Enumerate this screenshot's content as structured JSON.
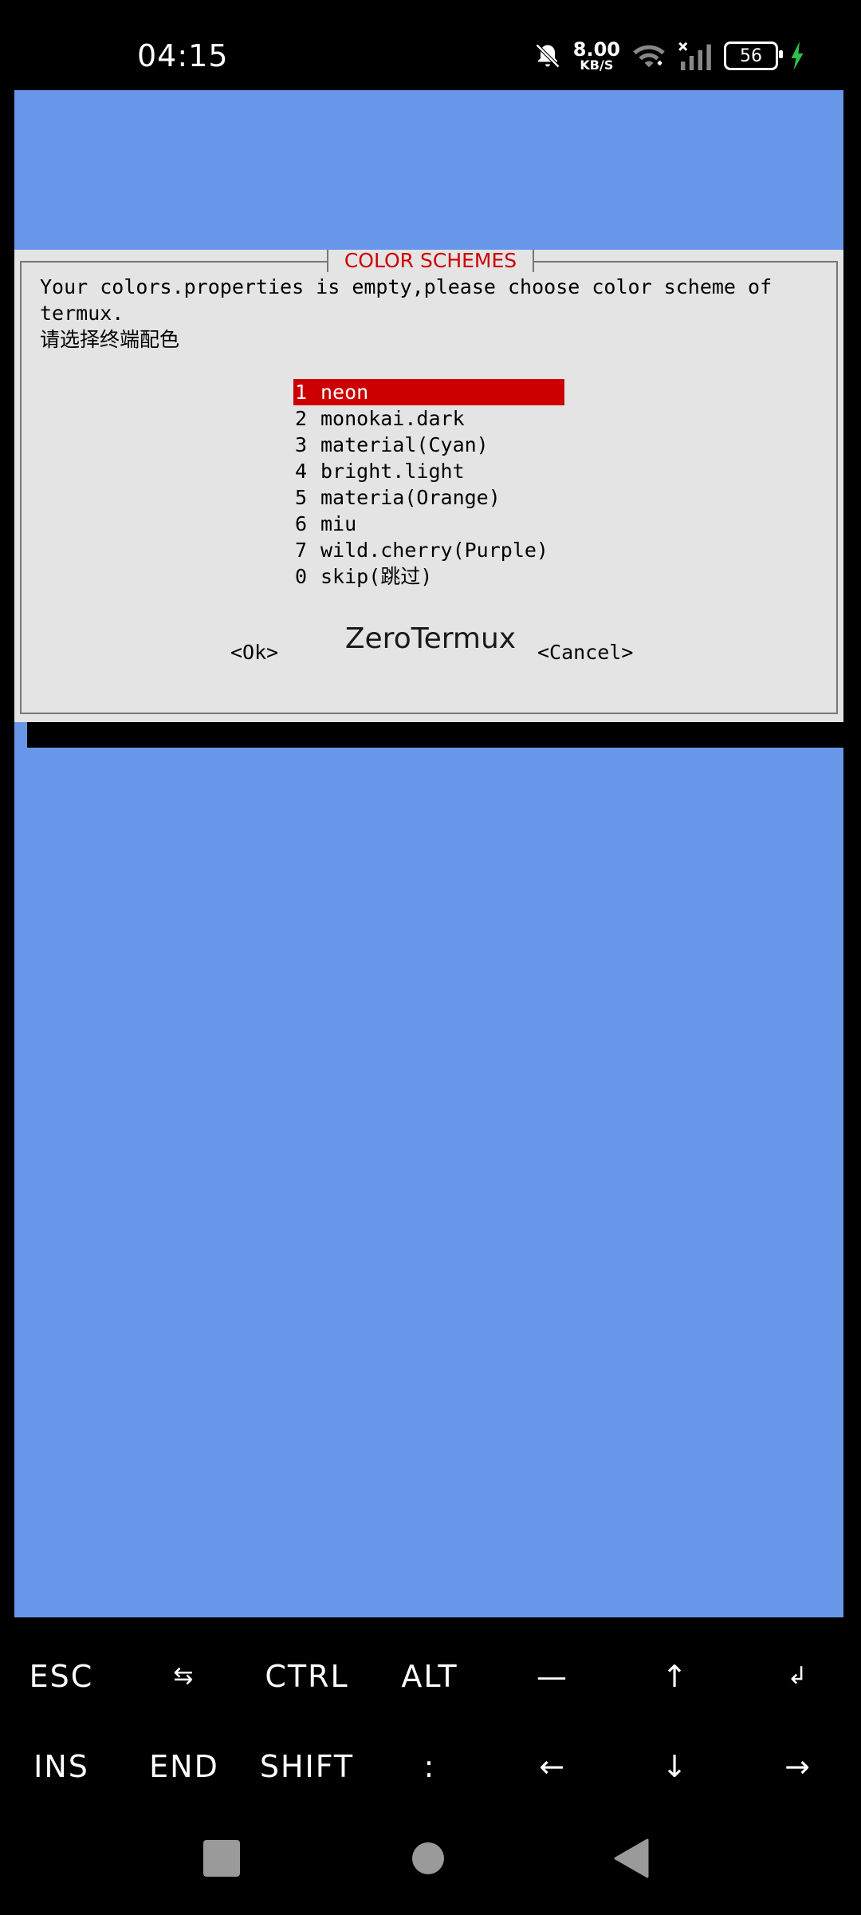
{
  "status_bar": {
    "time": "04:15",
    "net_speed_value": "8.00",
    "net_speed_unit": "KB/S",
    "battery": "56",
    "icons": [
      "bell-mute-icon",
      "wifi-icon",
      "signal-icon",
      "battery-icon",
      "charging-icon"
    ]
  },
  "dialog": {
    "title": "COLOR SCHEMES",
    "message_line1": "Your colors.properties is empty,please choose color scheme of",
    "message_line2": "termux.",
    "message_line3": "请选择终端配色",
    "options": [
      {
        "num": "1",
        "label": "neon",
        "selected": true
      },
      {
        "num": "2",
        "label": "monokai.dark"
      },
      {
        "num": "3",
        "label": "material(Cyan)"
      },
      {
        "num": "4",
        "label": "bright.light"
      },
      {
        "num": "5",
        "label": "materia(Orange)"
      },
      {
        "num": "6",
        "label": "miu"
      },
      {
        "num": "7",
        "label": "wild.cherry(Purple)"
      },
      {
        "num": "0",
        "label": "skip(跳过)"
      }
    ],
    "ok_label": "<Ok>",
    "cancel_label": "<Cancel>"
  },
  "watermark": "ZeroTermux",
  "extra_keys": {
    "row1": [
      "ESC",
      "⇆",
      "CTRL",
      "ALT",
      "—",
      "↑",
      "↲"
    ],
    "row2": [
      "INS",
      "END",
      "SHIFT",
      ":",
      "←",
      "↓",
      "→"
    ]
  },
  "colors": {
    "terminal_bg": "#6897e9",
    "dialog_bg": "#e4e4e4",
    "accent_red": "#cc0000"
  }
}
